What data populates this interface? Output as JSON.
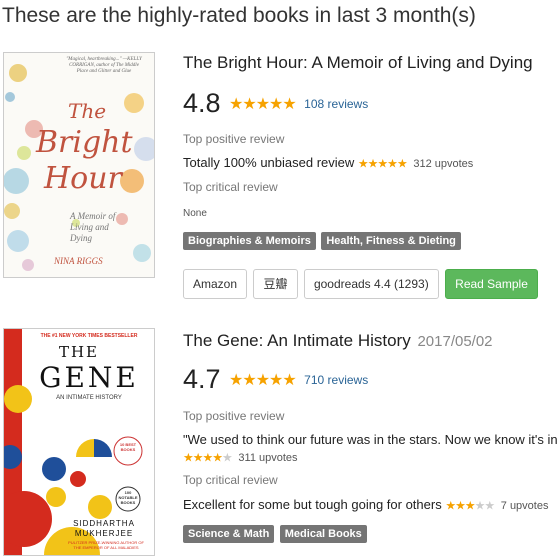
{
  "page": {
    "heading": "These are the highly-rated books in last 3 month(s)"
  },
  "books": [
    {
      "title": "The Bright Hour: A Memoir of Living and Dying",
      "date": "",
      "rating": "4.8",
      "stars": "★★★★★",
      "reviews": "108 reviews",
      "positive_label": "Top positive review",
      "positive_text": "Totally 100% unbiased review",
      "positive_stars": "★★★★★",
      "positive_upvotes": "312 upvotes",
      "critical_label": "Top critical review",
      "critical_text": "None",
      "tags": [
        "Biographies & Memoirs",
        "Health, Fitness & Dieting"
      ],
      "buttons": {
        "amazon": "Amazon",
        "douban": "豆瓣",
        "goodreads": "goodreads 4.4 (1293)",
        "sample": "Read Sample"
      },
      "cover": {
        "quote": "\"Magical, heartbreaking...\" —KELLY CORRIGAN, author of The Middle Place and Glitter and Glue",
        "title_line1": "The",
        "title_line2": "Bright",
        "title_line3": "Hour",
        "subtitle": "A Memoir of Living and Dying",
        "author": "NINA RIGGS"
      }
    },
    {
      "title": "The Gene: An Intimate History",
      "date": "2017/05/02",
      "rating": "4.7",
      "stars": "★★★★★",
      "reviews": "710 reviews",
      "positive_label": "Top positive review",
      "positive_text": "\"We used to think our future was in the stars. Now we know it's in our genes.\"",
      "positive_stars": "★★★★",
      "positive_stars_off": "★",
      "positive_upvotes": "311 upvotes",
      "critical_label": "Top critical review",
      "critical_text": "Excellent for some but tough going for others",
      "critical_stars": "★★★",
      "critical_stars_off": "★★",
      "critical_upvotes": "7 upvotes",
      "tags": [
        "Science & Math",
        "Medical Books"
      ],
      "cover": {
        "banner": "THE #1 NEW YORK TIMES BESTSELLER",
        "title_line1": "THE",
        "title_line2": "GENE",
        "subtitle": "AN INTIMATE HISTORY",
        "badge1": "10 BEST BOOKS",
        "badge2": "100 NOTABLE BOOKS",
        "author_line1": "SIDDHARTHA",
        "author_line2": "MUKHERJEE",
        "author_note": "PULITZER PRIZE-WINNING AUTHOR OF THE EMPEROR OF ALL MALADIES"
      }
    }
  ],
  "colors": {
    "star": "#f6a200",
    "link": "#2a6496",
    "tag_bg": "#757575",
    "sample_btn": "#5cb85c"
  }
}
